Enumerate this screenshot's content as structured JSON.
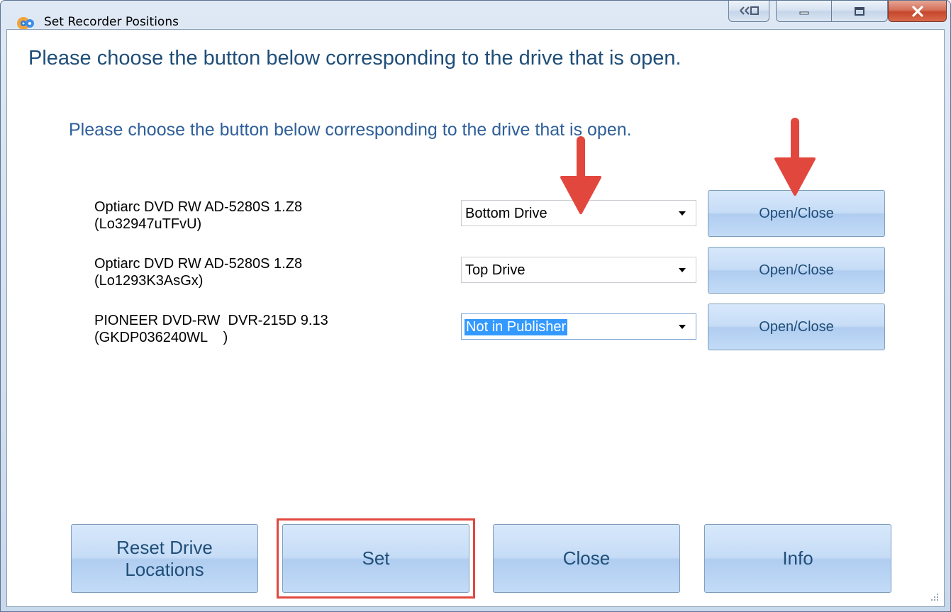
{
  "window": {
    "title": "Set Recorder Positions",
    "icon": "app-disc-icon",
    "caption_buttons": [
      "snap-icon",
      "minimize-icon",
      "maximize-icon",
      "close-icon"
    ],
    "close_glyph": "X"
  },
  "header": {
    "title": "Please choose the button below corresponding to the drive that is open.",
    "subtitle": "Please choose the button below corresponding to the drive that is open."
  },
  "drives": [
    {
      "name": "Optiarc DVD RW AD-5280S 1.Z8",
      "serial": "(Lo32947uTFvU)",
      "position": "Bottom Drive",
      "button": "Open/Close"
    },
    {
      "name": "Optiarc DVD RW AD-5280S 1.Z8",
      "serial": "(Lo1293K3AsGx)",
      "position": "Top Drive",
      "button": "Open/Close"
    },
    {
      "name": "PIONEER DVD-RW  DVR-215D 9.13",
      "serial": "(GKDP036240WL    )",
      "position": "Not in Publisher",
      "button": "Open/Close"
    }
  ],
  "footer": {
    "reset_line1": "Reset Drive",
    "reset_line2": "Locations",
    "set": "Set",
    "close": "Close",
    "info": "Info"
  },
  "colors": {
    "annotation": "#e2473e",
    "heading": "#1f4e79",
    "selection": "#3399ff"
  }
}
